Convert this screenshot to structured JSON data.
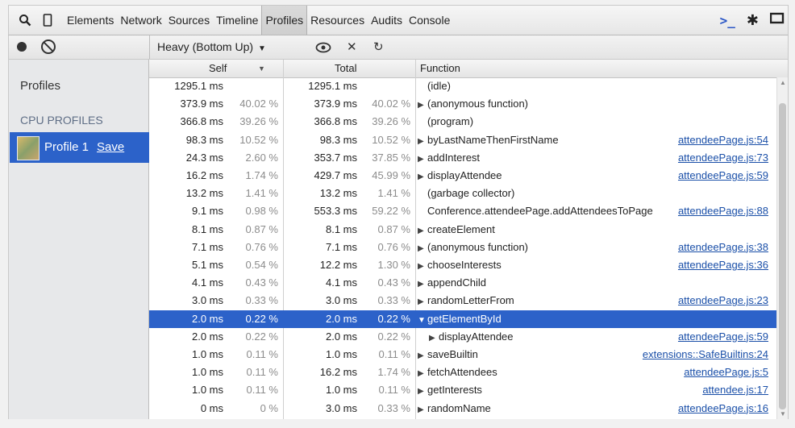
{
  "toolbar": {
    "tabs": [
      "Elements",
      "Network",
      "Sources",
      "Timeline",
      "Profiles",
      "Resources",
      "Audits",
      "Console"
    ],
    "active_tab": "Profiles"
  },
  "subbar": {
    "view_mode": "Heavy (Bottom Up)"
  },
  "sidebar": {
    "title": "Profiles",
    "section": "CPU PROFILES",
    "profile_label": "Profile 1",
    "save_label": "Save"
  },
  "grid": {
    "headers": {
      "self": "Self",
      "total": "Total",
      "function": "Function"
    },
    "rows": [
      {
        "self_ms": "1295.1 ms",
        "self_pct": "",
        "total_ms": "1295.1 ms",
        "total_pct": "",
        "tri": "",
        "fn": "(idle)",
        "link": ""
      },
      {
        "self_ms": "373.9 ms",
        "self_pct": "40.02 %",
        "total_ms": "373.9 ms",
        "total_pct": "40.02 %",
        "tri": "▶",
        "fn": "(anonymous function)",
        "link": ""
      },
      {
        "self_ms": "366.8 ms",
        "self_pct": "39.26 %",
        "total_ms": "366.8 ms",
        "total_pct": "39.26 %",
        "tri": "",
        "fn": "(program)",
        "link": ""
      },
      {
        "self_ms": "98.3 ms",
        "self_pct": "10.52 %",
        "total_ms": "98.3 ms",
        "total_pct": "10.52 %",
        "tri": "▶",
        "fn": "byLastNameThenFirstName",
        "link": "attendeePage.js:54"
      },
      {
        "self_ms": "24.3 ms",
        "self_pct": "2.60 %",
        "total_ms": "353.7 ms",
        "total_pct": "37.85 %",
        "tri": "▶",
        "fn": "addInterest",
        "link": "attendeePage.js:73"
      },
      {
        "self_ms": "16.2 ms",
        "self_pct": "1.74 %",
        "total_ms": "429.7 ms",
        "total_pct": "45.99 %",
        "tri": "▶",
        "fn": "displayAttendee",
        "link": "attendeePage.js:59"
      },
      {
        "self_ms": "13.2 ms",
        "self_pct": "1.41 %",
        "total_ms": "13.2 ms",
        "total_pct": "1.41 %",
        "tri": "",
        "fn": "(garbage collector)",
        "link": ""
      },
      {
        "self_ms": "9.1 ms",
        "self_pct": "0.98 %",
        "total_ms": "553.3 ms",
        "total_pct": "59.22 %",
        "tri": "",
        "fn": "Conference.attendeePage.addAttendeesToPage",
        "link": "attendeePage.js:88"
      },
      {
        "self_ms": "8.1 ms",
        "self_pct": "0.87 %",
        "total_ms": "8.1 ms",
        "total_pct": "0.87 %",
        "tri": "▶",
        "fn": "createElement",
        "link": ""
      },
      {
        "self_ms": "7.1 ms",
        "self_pct": "0.76 %",
        "total_ms": "7.1 ms",
        "total_pct": "0.76 %",
        "tri": "▶",
        "fn": "(anonymous function)",
        "link": "attendeePage.js:38"
      },
      {
        "self_ms": "5.1 ms",
        "self_pct": "0.54 %",
        "total_ms": "12.2 ms",
        "total_pct": "1.30 %",
        "tri": "▶",
        "fn": "chooseInterests",
        "link": "attendeePage.js:36"
      },
      {
        "self_ms": "4.1 ms",
        "self_pct": "0.43 %",
        "total_ms": "4.1 ms",
        "total_pct": "0.43 %",
        "tri": "▶",
        "fn": "appendChild",
        "link": ""
      },
      {
        "self_ms": "3.0 ms",
        "self_pct": "0.33 %",
        "total_ms": "3.0 ms",
        "total_pct": "0.33 %",
        "tri": "▶",
        "fn": "randomLetterFrom",
        "link": "attendeePage.js:23"
      },
      {
        "self_ms": "2.0 ms",
        "self_pct": "0.22 %",
        "total_ms": "2.0 ms",
        "total_pct": "0.22 %",
        "tri": "▼",
        "fn": "getElementById",
        "link": "",
        "selected": true
      },
      {
        "self_ms": "2.0 ms",
        "self_pct": "0.22 %",
        "total_ms": "2.0 ms",
        "total_pct": "0.22 %",
        "tri": "▶",
        "fn": "displayAttendee",
        "link": "attendeePage.js:59",
        "indent": true
      },
      {
        "self_ms": "1.0 ms",
        "self_pct": "0.11 %",
        "total_ms": "1.0 ms",
        "total_pct": "0.11 %",
        "tri": "▶",
        "fn": "saveBuiltin",
        "link": "extensions::SafeBuiltins:24"
      },
      {
        "self_ms": "1.0 ms",
        "self_pct": "0.11 %",
        "total_ms": "16.2 ms",
        "total_pct": "1.74 %",
        "tri": "▶",
        "fn": "fetchAttendees",
        "link": "attendeePage.js:5"
      },
      {
        "self_ms": "1.0 ms",
        "self_pct": "0.11 %",
        "total_ms": "1.0 ms",
        "total_pct": "0.11 %",
        "tri": "▶",
        "fn": "getInterests",
        "link": "attendee.js:17"
      },
      {
        "self_ms": "0 ms",
        "self_pct": "0 %",
        "total_ms": "3.0 ms",
        "total_pct": "0.33 %",
        "tri": "▶",
        "fn": "randomName",
        "link": "attendeePage.js:16"
      }
    ]
  }
}
